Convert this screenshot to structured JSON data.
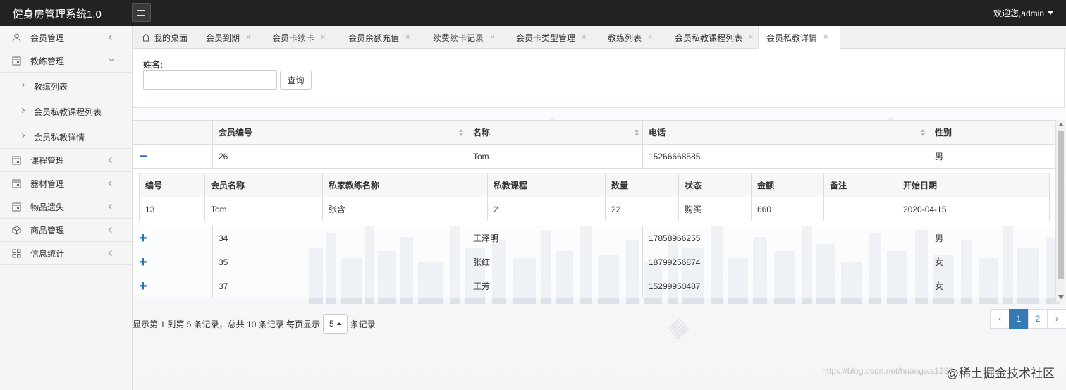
{
  "header": {
    "brand": "健身房管理系统1.0",
    "user": "欢迎您,admin"
  },
  "sidebar": {
    "items": [
      {
        "label": "会员管理",
        "icon": "user-icon"
      },
      {
        "label": "教练管理",
        "icon": "doc-icon"
      },
      {
        "label": "课程管理",
        "icon": "doc-icon"
      },
      {
        "label": "器材管理",
        "icon": "doc-icon"
      },
      {
        "label": "物品遗失",
        "icon": "doc-icon"
      },
      {
        "label": "商品管理",
        "icon": "box-icon"
      },
      {
        "label": "信息统计",
        "icon": "grid-icon"
      }
    ],
    "subitems": [
      {
        "label": "教练列表"
      },
      {
        "label": "会员私教课程列表"
      },
      {
        "label": "会员私教详情"
      }
    ]
  },
  "tabs": [
    {
      "label": "我的桌面"
    },
    {
      "label": "会员到期"
    },
    {
      "label": "会员卡续卡"
    },
    {
      "label": "会员余额充值"
    },
    {
      "label": "续费续卡记录"
    },
    {
      "label": "会员卡类型管理"
    },
    {
      "label": "教练列表"
    },
    {
      "label": "会员私教课程列表"
    },
    {
      "label": "会员私教详情"
    }
  ],
  "tab_close": "×",
  "search": {
    "label": "姓名:",
    "value": "",
    "button": "查询"
  },
  "table": {
    "headers": [
      "会员编号",
      "名称",
      "电话",
      "性别"
    ],
    "rows": [
      {
        "toggle": "−",
        "id": "26",
        "name": "Tom",
        "phone": "15266668585",
        "gender": "男"
      },
      {
        "toggle": "+",
        "id": "34",
        "name": "王泽明",
        "phone": "17858966255",
        "gender": "男"
      },
      {
        "toggle": "+",
        "id": "35",
        "name": "张红",
        "phone": "18799256874",
        "gender": "女"
      },
      {
        "toggle": "+",
        "id": "37",
        "name": "王芳",
        "phone": "15299950487",
        "gender": "女"
      }
    ],
    "detail": {
      "headers": [
        "编号",
        "会员名称",
        "私家教练名称",
        "私教课程",
        "数量",
        "状态",
        "金额",
        "备注",
        "开始日期"
      ],
      "row": [
        "13",
        "Tom",
        "张含",
        "2",
        "22",
        "购买",
        "660",
        "",
        "2020-04-15"
      ]
    }
  },
  "pagination": {
    "info": "显示第 1 到第 5 条记录，总共 10 条记录 每页显示",
    "page_size": "5",
    "suffix": "条记录",
    "prev": "‹",
    "pages": [
      "1",
      "2"
    ],
    "next": "›"
  },
  "footer": {
    "brand": "@稀土掘金技术社区",
    "url": "https://blog.csdn.net/huangwa1233"
  },
  "colors": {
    "topbar": "#222222",
    "accent": "#337ab7",
    "expander": "#2a6cb5"
  }
}
